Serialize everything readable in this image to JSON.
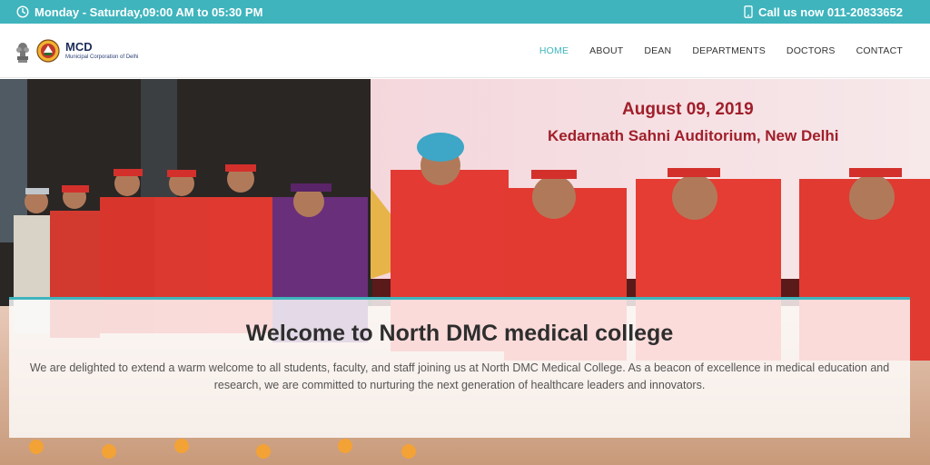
{
  "topbar": {
    "hours": "Monday - Saturday,09:00 AM to 05:30 PM",
    "phone": "Call us now 011-20833652",
    "color": "#3fb4bd"
  },
  "brand": {
    "name": "MCD",
    "subtitle": "Municipal Corporation of Delhi"
  },
  "nav": {
    "items": [
      {
        "label": "HOME",
        "active": true
      },
      {
        "label": "ABOUT"
      },
      {
        "label": "DEAN"
      },
      {
        "label": "DEPARTMENTS"
      },
      {
        "label": "DOCTORS"
      },
      {
        "label": "CONTACT"
      }
    ]
  },
  "hero": {
    "banner_date": "August 09, 2019",
    "banner_venue": "Kedarnath Sahni Auditorium, New Delhi",
    "welcome_title": "Welcome to North DMC medical college",
    "welcome_body": "We are delighted to extend a warm welcome to all students, faculty, and staff joining us at North DMC Medical College. As a beacon of excellence in medical education and research, we are committed to nurturing the next generation of healthcare leaders and innovators."
  }
}
